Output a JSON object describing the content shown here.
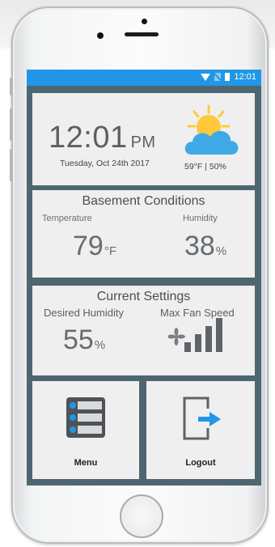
{
  "status_bar": {
    "time": "12:01"
  },
  "weather": {
    "time": "12:01",
    "ampm": "PM",
    "date": "Tuesday, Oct 24th 2017",
    "summary": "59°F | 50%",
    "icon": "partly-sunny-icon"
  },
  "basement": {
    "title": "Basement Conditions",
    "temperature_label": "Temperature",
    "temperature_value": "79",
    "temperature_unit": "°F",
    "humidity_label": "Humidity",
    "humidity_value": "38",
    "humidity_unit": "%"
  },
  "settings": {
    "title": "Current Settings",
    "desired_humidity_label": "Desired Humidity",
    "desired_humidity_value": "55",
    "desired_humidity_unit": "%",
    "max_fan_speed_label": "Max Fan Speed",
    "fan_speed_level": 4,
    "fan_speed_max": 4
  },
  "buttons": {
    "menu": "Menu",
    "logout": "Logout"
  },
  "colors": {
    "accent": "#2196e6",
    "frame": "#4e6670",
    "panel": "#efefef",
    "sun": "#ffc93a",
    "cloud": "#3fa9e8"
  }
}
